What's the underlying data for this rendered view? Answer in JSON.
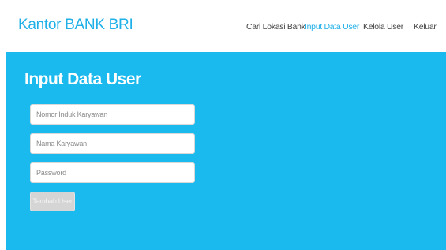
{
  "navbar": {
    "brand": "Kantor BANK BRI",
    "links": [
      {
        "label": "Cari Lokasi Bank",
        "active": false
      },
      {
        "label": "Input Data User",
        "active": true
      },
      {
        "label": "Kelola User",
        "active": false
      },
      {
        "label": "Keluar",
        "active": false
      }
    ]
  },
  "form": {
    "title": "Input Data User",
    "nik_placeholder": "Nomor Induk Karyawan",
    "nik_value": "",
    "nama_placeholder": "Nama Karyawan",
    "nama_value": "",
    "password_placeholder": "Password",
    "password_value": "",
    "submit_label": "Tambah User"
  },
  "colors": {
    "accent": "#1fb0e8",
    "hero_background": "#1abaee",
    "button_disabled": "#d5d5d5"
  }
}
